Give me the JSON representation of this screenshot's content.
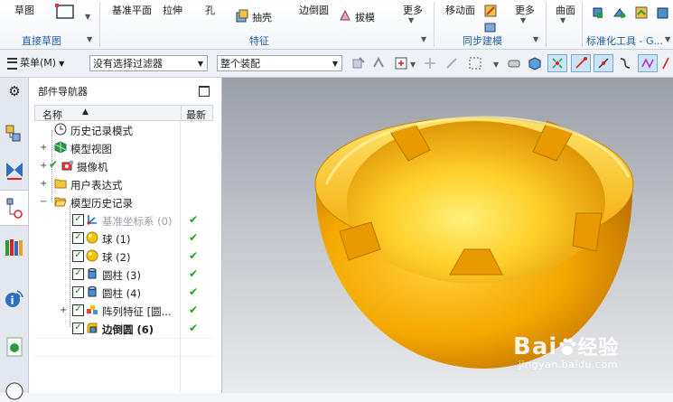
{
  "ribbon": {
    "items": {
      "sketch": "草图",
      "datum_plane": "基准平面",
      "extrude": "拉伸",
      "hole": "孔",
      "shell": "抽壳",
      "edge_blend": "边倒圆",
      "draft": "拔模",
      "more1": "更多",
      "move_face": "移动面",
      "more2": "更多",
      "surface": "曲面"
    },
    "groups": {
      "direct_sketch": "直接草图",
      "feature": "特征",
      "sync_modeling": "同步建模",
      "std_tools": "标准化工具 - G..."
    }
  },
  "toolbar": {
    "menu_label": "菜单(M)",
    "filter_value": "没有选择过滤器",
    "assembly_value": "整个装配"
  },
  "navigator": {
    "title": "部件导航器",
    "col_name": "名称",
    "col_latest": "最新",
    "rows": [
      {
        "label": "历史记录模式",
        "icon": "clock-icon"
      },
      {
        "label": "模型视图",
        "icon": "model-view-icon"
      },
      {
        "label": "摄像机",
        "icon": "camera-icon"
      },
      {
        "label": "用户表达式",
        "icon": "folder-icon"
      },
      {
        "label": "模型历史记录",
        "icon": "folder-open-icon"
      },
      {
        "label": "基准坐标系 (0)",
        "icon": "csys-icon"
      },
      {
        "label": "球 (1)",
        "icon": "sphere-icon"
      },
      {
        "label": "球 (2)",
        "icon": "sphere-icon"
      },
      {
        "label": "圆柱 (3)",
        "icon": "cylinder-icon"
      },
      {
        "label": "圆柱 (4)",
        "icon": "cylinder-icon"
      },
      {
        "label": "阵列特征 [圆...",
        "icon": "pattern-icon"
      },
      {
        "label": "边倒圆 (6)",
        "icon": "edge-blend-icon"
      }
    ]
  },
  "watermark": {
    "brand": "Bai",
    "brand2": "经验",
    "url": "jingyan.baidu.com"
  },
  "colors": {
    "model_yellow": "#f5b400",
    "link_blue": "#1f5fa8",
    "check_green": "#1aa31a"
  }
}
